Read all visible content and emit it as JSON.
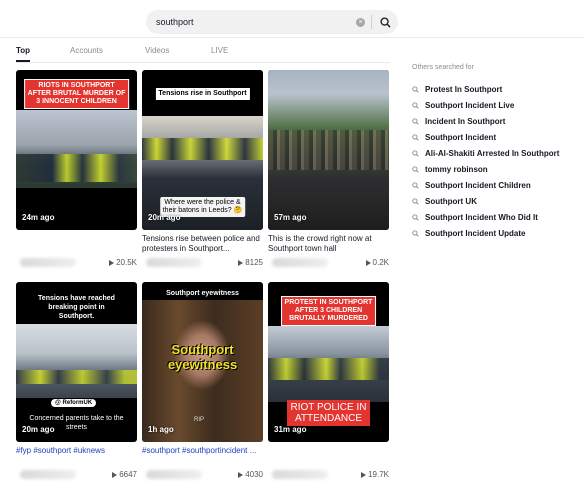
{
  "search": {
    "value": "southport"
  },
  "tabs": [
    "Top",
    "Accounts",
    "Videos",
    "LIVE"
  ],
  "videos": [
    {
      "banner": "RIOTS IN SOUTHPORT AFTER BRUTAL MURDER OF 3 INNOCENT CHILDREN",
      "ago": "24m ago",
      "caption": "",
      "views": "20.5K"
    },
    {
      "banner": "Tensions rise in Southport",
      "overlay": "Where were the police & their batons in Leeds? 🤔",
      "ago": "20m ago",
      "caption": "Tensions rise between police and protesters in Southport...",
      "views": "8125"
    },
    {
      "ago": "57m ago",
      "caption": "This is the crowd right now at Southport town hall",
      "views": "0.2K"
    },
    {
      "banner": "Tensions have reached breaking point in Southport.",
      "overlay_badge": "@ ReformUK",
      "overlay": "Concerned parents take to the streets",
      "ago": "20m ago",
      "caption": "#fyp #southport #uknews",
      "views": "6647"
    },
    {
      "banner": "Southport eyewitness",
      "overlay": "Southport eyewitness",
      "rip": "RIP",
      "ago": "1h ago",
      "caption": "#southport #southportincident ...",
      "views": "4030"
    },
    {
      "banner": "PROTEST IN SOUTHPORT AFTER 3 CHILDREN BRUTALLY MURDERED",
      "overlay": "RIOT POLICE IN ATTENDANCE",
      "ago": "31m ago",
      "caption": "",
      "views": "19.7K"
    }
  ],
  "sidebar": {
    "title": "Others searched for",
    "items": [
      "Protest In Southport",
      "Southport Incident Live",
      "Incident In Southport",
      "Southport Incident",
      "Ali-Al-Shakiti Arrested In Southport",
      "tommy robinson",
      "Southport Incident Children",
      "Southport UK",
      "Southport Incident Who Did It",
      "Southport Incident Update"
    ]
  }
}
